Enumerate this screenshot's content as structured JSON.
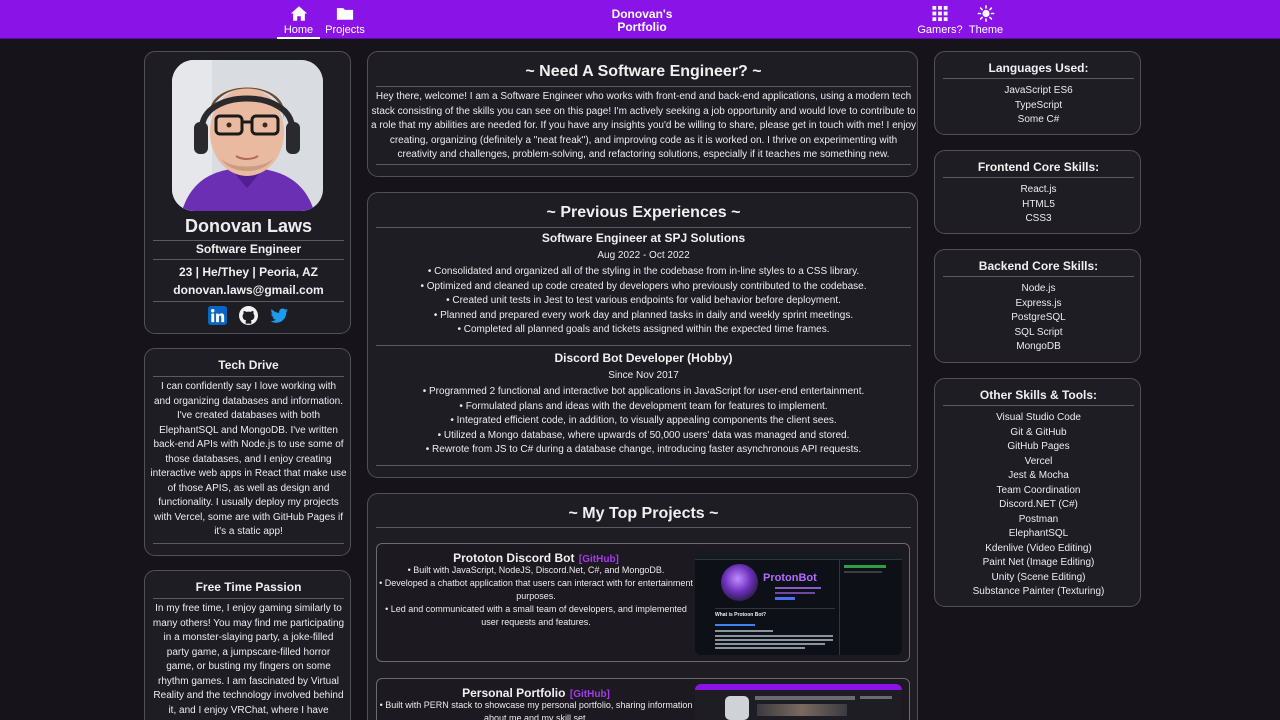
{
  "nav": {
    "home": "Home",
    "projects": "Projects",
    "brand_line1": "Donovan's",
    "brand_line2": "Portfolio",
    "gamers": "Gamers?",
    "theme": "Theme"
  },
  "colors": {
    "accent": "#8a14e8",
    "link": "#a53be8",
    "panel": "#1f1d24",
    "background": "#16141a"
  },
  "icons": [
    "home-icon",
    "folder-icon",
    "grid-icon",
    "sun-icon",
    "linkedin-icon",
    "github-icon",
    "twitter-icon"
  ],
  "profile": {
    "name": "Donovan Laws",
    "title": "Software Engineer",
    "info": "23 | He/They | Peoria, AZ",
    "email": "donovan.laws@gmail.com"
  },
  "tech_drive": {
    "heading": "Tech Drive",
    "lines": [
      "I can confidently say I love working with",
      "and organizing databases and information.",
      "I've created databases with both",
      "ElephantSQL and MongoDB. I've written",
      "back-end APIs with Node.js to use some of",
      "those databases, and I enjoy creating",
      "interactive web apps in React that make use",
      "of those APIS, as well as design and",
      "functionality. I usually deploy my projects",
      "with Vercel, some are with GitHub Pages if",
      "it's a static app!"
    ]
  },
  "free_time": {
    "heading": "Free Time Passion",
    "lines": [
      "In my free time, I enjoy gaming similarly to",
      "many others! You may find me participating",
      "in a monster-slaying party, a joke-filled",
      "party game, a jumpscare-filled horror",
      "game, or busting my fingers on some",
      "rhythm games. I am fascinated by Virtual",
      "Reality and the technology involved behind",
      "it, and I enjoy VRChat, where I have"
    ]
  },
  "intro": {
    "heading": "~ Need A Software Engineer? ~",
    "lines": [
      "Hey there, welcome! I am a Software Engineer who works with front-end and back-end applications, using a modern tech",
      "stack consisting of the skills you can see on this page! I'm actively seeking a job opportunity and would love to contribute to",
      "a role that my abilities are needed for. If you have any insights you'd be willing to share, please get in touch with me! I enjoy",
      "creating, organizing (definitely a \"neat freak\"), and improving code as it is worked on. I thrive on experimenting with",
      "creativity and challenges, problem-solving, and refactoring solutions, especially if it teaches me something new."
    ]
  },
  "experience": {
    "heading": "~ Previous Experiences ~",
    "jobs": [
      {
        "title": "Software Engineer at SPJ Solutions",
        "dates": "Aug 2022 - Oct 2022",
        "bullets": [
          "• Consolidated and organized all of the styling in the codebase from in-line styles to a CSS library.",
          "• Optimized and cleaned up code created by developers who previously contributed to the codebase.",
          "• Created unit tests in Jest to test various endpoints for valid behavior before deployment.",
          "• Planned and prepared every work day and planned tasks in daily and weekly sprint meetings.",
          "• Completed all planned goals and tickets assigned within the expected time frames."
        ]
      },
      {
        "title": "Discord Bot Developer (Hobby)",
        "dates": "Since Nov 2017",
        "bullets": [
          "• Programmed 2 functional and interactive bot applications in JavaScript for user-end entertainment.",
          "• Formulated plans and ideas with the development team for features to implement.",
          "• Integrated efficient code, in addition, to visually appealing components the client sees.",
          "• Utilized a Mongo database, where upwards of 50,000 users' data was managed and stored.",
          "• Rewrote from JS to C# during a database change, introducing faster asynchronous API requests."
        ]
      }
    ]
  },
  "projects": {
    "heading": "~ My Top Projects ~",
    "items": [
      {
        "name": "Prototon Discord Bot",
        "link": "[GitHub]",
        "lines": [
          "• Built with JavaScript, NodeJS, Discord.Net, C#, and MongoDB.",
          "• Developed a chatbot application that users can interact with for entertainment",
          "purposes.",
          "• Led and communicated with a small team of developers, and implemented",
          "user requests and features."
        ],
        "shot_title": "ProtonBot",
        "shot_text": "What is Protoon Bot?"
      },
      {
        "name": "Personal Portfolio",
        "link": "[GitHub]",
        "lines": [
          "• Built with PERN stack to showcase my personal portfolio, sharing information",
          "about me and my skill set."
        ]
      }
    ]
  },
  "skills": {
    "languages": {
      "heading": "Languages Used:",
      "items": [
        "JavaScript ES6",
        "TypeScript",
        "Some C#"
      ]
    },
    "frontend": {
      "heading": "Frontend Core Skills:",
      "items": [
        "React.js",
        "HTML5",
        "CSS3"
      ]
    },
    "backend": {
      "heading": "Backend Core Skills:",
      "items": [
        "Node.js",
        "Express.js",
        "PostgreSQL",
        "SQL Script",
        "MongoDB"
      ]
    },
    "other": {
      "heading": "Other Skills & Tools:",
      "items": [
        "Visual Studio Code",
        "Git & GitHub",
        "GitHub Pages",
        "Vercel",
        "Jest & Mocha",
        "Team Coordination",
        "Discord.NET (C#)",
        "Postman",
        "ElephantSQL",
        "Kdenlive (Video Editing)",
        "Paint Net (Image Editing)",
        "Unity (Scene Editing)",
        "Substance Painter (Texturing)"
      ]
    }
  }
}
